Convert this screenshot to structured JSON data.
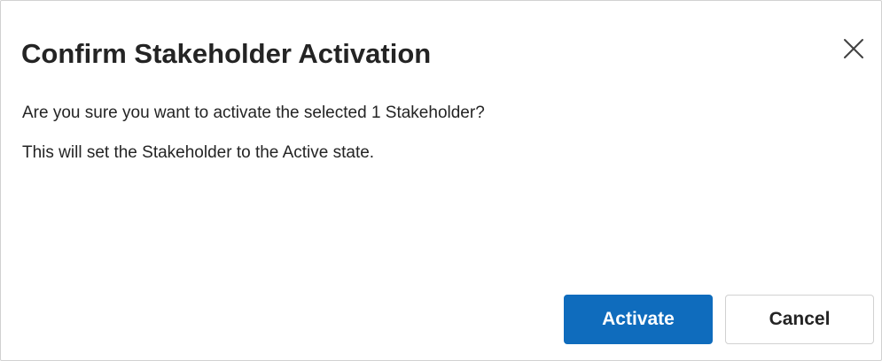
{
  "dialog": {
    "title": "Confirm Stakeholder Activation",
    "close_icon": "close-icon",
    "messages": [
      "Are you sure you want to activate the selected 1 Stakeholder?",
      "This will set the Stakeholder to the Active state."
    ],
    "buttons": {
      "activate_label": "Activate",
      "cancel_label": "Cancel"
    }
  },
  "colors": {
    "primary": "#0f6cbd",
    "primary_text": "#ffffff",
    "text": "#242424",
    "border": "#d1d1d1"
  }
}
